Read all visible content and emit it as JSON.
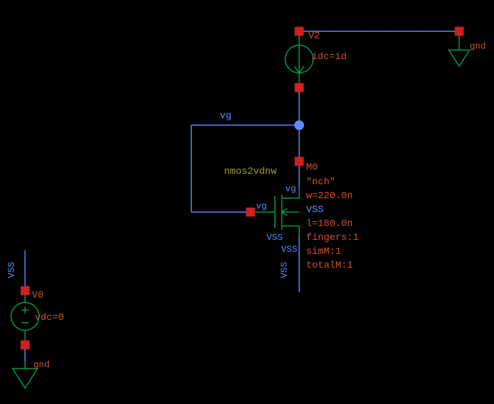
{
  "components": {
    "v2": {
      "name": "V2",
      "param": "idc=id"
    },
    "m0": {
      "name": "M0",
      "model": "\"nch\"",
      "w": "w=220.0n",
      "l": "l=180.0n",
      "fingers": "fingers:1",
      "simM": "simM:1",
      "totalM": "totalM:1",
      "celltype": "nmos2vdnw"
    },
    "v0": {
      "name": "V0",
      "param": "vdc=0"
    }
  },
  "nets": {
    "vg": "vg",
    "VSS": "VSS",
    "gnd": "gnd"
  }
}
